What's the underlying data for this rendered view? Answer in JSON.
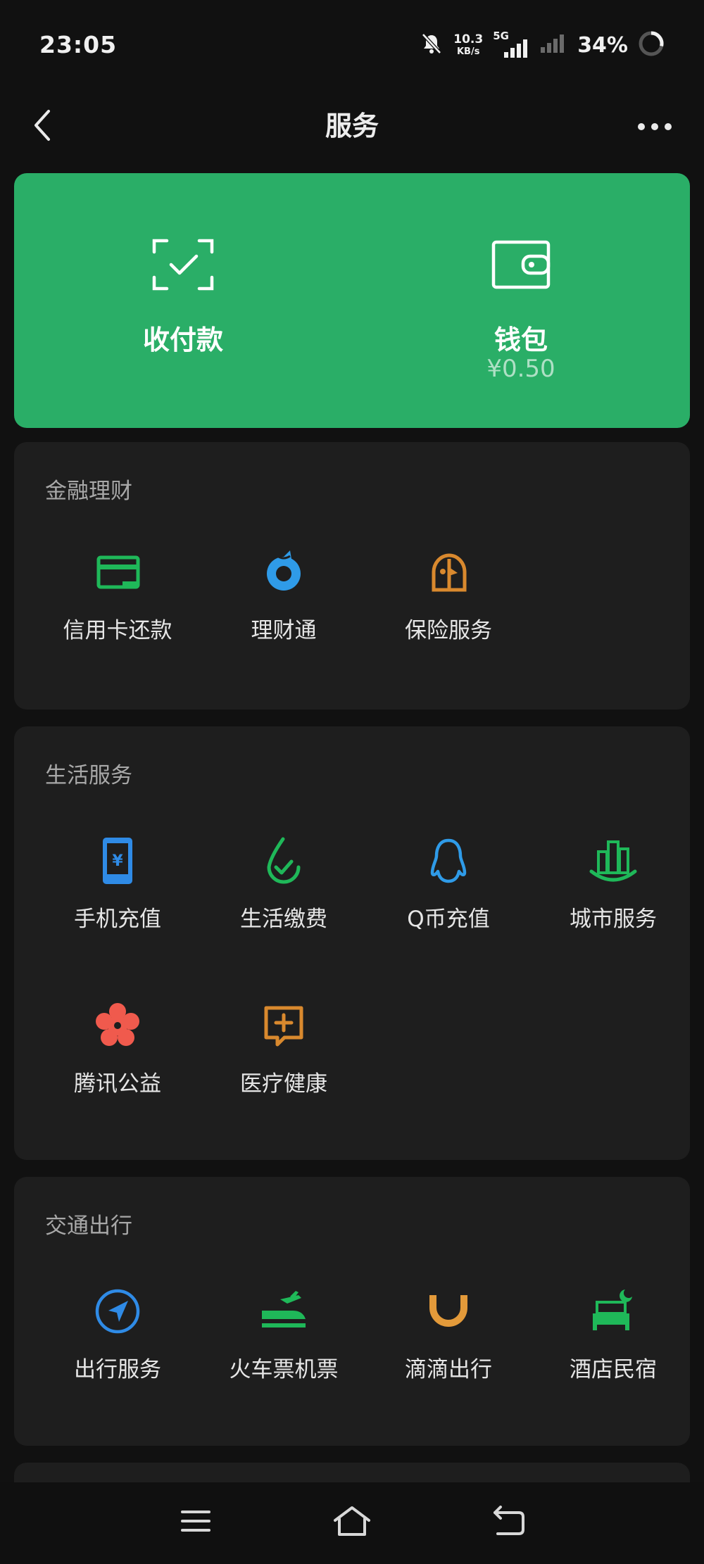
{
  "status_bar": {
    "time": "23:05",
    "net_speed_value": "10.3",
    "net_speed_unit": "KB/s",
    "network_type": "5G",
    "battery": "34%"
  },
  "header": {
    "title": "服务",
    "back_icon": "chevron-left-icon",
    "more_icon": "more-horizontal-icon"
  },
  "top_card": {
    "background": "#2aae67",
    "items": [
      {
        "label": "收付款",
        "icon": "scan-check-icon"
      },
      {
        "label": "钱包",
        "sub": "¥0.50",
        "icon": "wallet-icon"
      }
    ]
  },
  "sections": [
    {
      "title": "金融理财",
      "items": [
        {
          "label": "信用卡还款",
          "icon": "credit-card-icon",
          "color": "#1fb859"
        },
        {
          "label": "理财通",
          "icon": "wealth-icon",
          "color": "#2f9be8"
        },
        {
          "label": "保险服务",
          "icon": "insurance-icon",
          "color": "#d9892e"
        }
      ]
    },
    {
      "title": "生活服务",
      "items": [
        {
          "label": "手机充值",
          "icon": "phone-recharge-icon",
          "color": "#2f8be6"
        },
        {
          "label": "生活缴费",
          "icon": "utility-bill-icon",
          "color": "#1fb859"
        },
        {
          "label": "Q币充值",
          "icon": "qq-icon",
          "color": "#2f9be8"
        },
        {
          "label": "城市服务",
          "icon": "city-icon",
          "color": "#1fb859"
        },
        {
          "label": "腾讯公益",
          "icon": "charity-flower-icon",
          "color": "#f05a4d"
        },
        {
          "label": "医疗健康",
          "icon": "medical-icon",
          "color": "#d9892e"
        }
      ]
    },
    {
      "title": "交通出行",
      "items": [
        {
          "label": "出行服务",
          "icon": "navigation-icon",
          "color": "#2f8be6"
        },
        {
          "label": "火车票机票",
          "icon": "train-plane-icon",
          "color": "#1fb859"
        },
        {
          "label": "滴滴出行",
          "icon": "didi-icon",
          "color": "#e39a3a"
        },
        {
          "label": "酒店民宿",
          "icon": "hotel-bed-icon",
          "color": "#1fb859"
        }
      ]
    }
  ],
  "system_nav": {
    "menu_icon": "menu-icon",
    "home_icon": "home-icon",
    "back_icon": "back-arrow-icon"
  }
}
